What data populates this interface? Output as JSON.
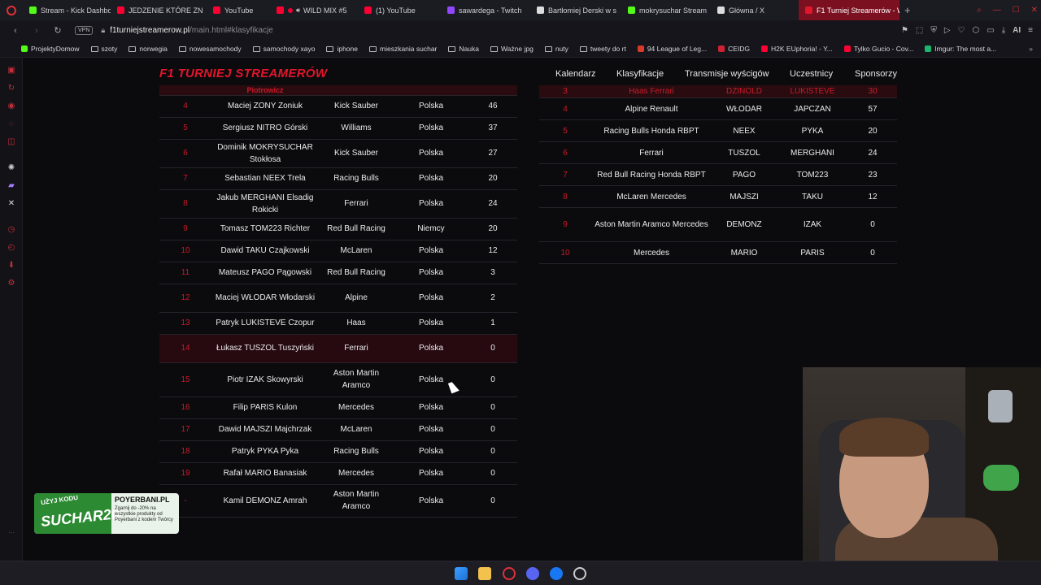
{
  "browser": {
    "tabs": [
      {
        "label": "Stream - Kick Dashbo",
        "color": "#53fc18",
        "active": false
      },
      {
        "label": "JEDZENIE KTÓRE ZN",
        "color": "#ff0033",
        "active": false
      },
      {
        "label": "YouTube",
        "color": "#ff0033",
        "active": false
      },
      {
        "label": "WILD MIX #5",
        "color": "#ff0033",
        "active": false
      },
      {
        "label": "(1) YouTube",
        "color": "#ff0033",
        "active": false
      },
      {
        "label": "sawardega - Twitch",
        "color": "#9146ff",
        "active": false
      },
      {
        "label": "Bartłomiej Derski w s",
        "color": "#dddddd",
        "active": false
      },
      {
        "label": "mokrysuchar Stream",
        "color": "#53fc18",
        "active": false
      },
      {
        "label": "Główna / X",
        "color": "#dddddd",
        "active": false
      },
      {
        "label": "F1 Turniej Streamerów - W",
        "color": "#e0162b",
        "active": true
      }
    ],
    "new_tab": "+",
    "url_host": "f1turniejstreamerow.pl",
    "url_path": "/main.html#klasyfikacje",
    "vpn_label": "VPN",
    "ai_label": "AI",
    "bookmarks": [
      {
        "label": "ProjektyDomow",
        "kind": "dot",
        "color": "#53fc18"
      },
      {
        "label": "szoty",
        "kind": "folder"
      },
      {
        "label": "norwegia",
        "kind": "folder"
      },
      {
        "label": "nowesamochody",
        "kind": "folder"
      },
      {
        "label": "samochody xayo",
        "kind": "folder"
      },
      {
        "label": "iphone",
        "kind": "folder"
      },
      {
        "label": "mieszkania suchar",
        "kind": "folder"
      },
      {
        "label": "Nauka",
        "kind": "folder"
      },
      {
        "label": "Ważne jpg",
        "kind": "folder"
      },
      {
        "label": "nuty",
        "kind": "folder"
      },
      {
        "label": "tweety do rt",
        "kind": "folder"
      },
      {
        "label": "94 League of Leg...",
        "kind": "dot",
        "color": "#d83a2a"
      },
      {
        "label": "CEIDG",
        "kind": "dot",
        "color": "#cc2233"
      },
      {
        "label": "H2K EUphoria! - Y...",
        "kind": "dot",
        "color": "#ff0033"
      },
      {
        "label": "Tylko Gucio - Cov...",
        "kind": "dot",
        "color": "#ff0033"
      },
      {
        "label": "Imgur: The most a...",
        "kind": "dot",
        "color": "#1bb76e"
      }
    ]
  },
  "site": {
    "logo": "F1 TURNIEJ STREAMERÓW",
    "nav": [
      "Kalendarz",
      "Klasyfikacje",
      "Transmisje wyścigów",
      "Uczestnicy",
      "Sponsorzy"
    ],
    "accent": "#e0162b"
  },
  "drivers_table": {
    "partial_top_label": "Piotrowicz",
    "rows": [
      {
        "pos": "4",
        "name": "Maciej ZONY Zoniuk",
        "team": "Kick Sauber",
        "country": "Polska",
        "points": "46"
      },
      {
        "pos": "5",
        "name": "Sergiusz NITRO Górski",
        "team": "Williams",
        "country": "Polska",
        "points": "37"
      },
      {
        "pos": "6",
        "name": "Dominik MOKRYSUCHAR Stokłosa",
        "team": "Kick Sauber",
        "country": "Polska",
        "points": "27"
      },
      {
        "pos": "7",
        "name": "Sebastian NEEX Trela",
        "team": "Racing Bulls",
        "country": "Polska",
        "points": "20"
      },
      {
        "pos": "8",
        "name": "Jakub MERGHANI Elsadig Rokicki",
        "team": "Ferrari",
        "country": "Polska",
        "points": "24"
      },
      {
        "pos": "9",
        "name": "Tomasz TOM223 Richter",
        "team": "Red Bull Racing",
        "country": "Niemcy",
        "points": "20"
      },
      {
        "pos": "10",
        "name": "Dawid TAKU Czajkowski",
        "team": "McLaren",
        "country": "Polska",
        "points": "12"
      },
      {
        "pos": "11",
        "name": "Mateusz PAGO Pągowski",
        "team": "Red Bull Racing",
        "country": "Polska",
        "points": "3"
      },
      {
        "pos": "12",
        "name": "Maciej WŁODAR Włodarski",
        "team": "Alpine",
        "country": "Polska",
        "points": "2"
      },
      {
        "pos": "13",
        "name": "Patryk LUKISTEVE Czopur",
        "team": "Haas",
        "country": "Polska",
        "points": "1"
      },
      {
        "pos": "14",
        "name": "Łukasz TUSZOL Tuszyński",
        "team": "Ferrari",
        "country": "Polska",
        "points": "0"
      },
      {
        "pos": "15",
        "name": "Piotr IZAK Skowyrski",
        "team": "Aston Martin Aramco",
        "country": "Polska",
        "points": "0"
      },
      {
        "pos": "16",
        "name": "Filip PARIS Kulon",
        "team": "Mercedes",
        "country": "Polska",
        "points": "0"
      },
      {
        "pos": "17",
        "name": "Dawid MAJSZI Majchrzak",
        "team": "McLaren",
        "country": "Polska",
        "points": "0"
      },
      {
        "pos": "18",
        "name": "Patryk PYKA Pyka",
        "team": "Racing Bulls",
        "country": "Polska",
        "points": "0"
      },
      {
        "pos": "19",
        "name": "Rafał MARIO Banasiak",
        "team": "Mercedes",
        "country": "Polska",
        "points": "0"
      },
      {
        "pos": "-",
        "name": "Kamil DEMONZ Amrah",
        "team": "Aston Martin Aramco",
        "country": "Polska",
        "points": "0"
      }
    ]
  },
  "teams_table": {
    "partial_top": {
      "pos": "3",
      "team": "Haas Ferrari",
      "d1": "DZINOLD",
      "d2": "LUKISTEVE",
      "points": "30"
    },
    "rows": [
      {
        "pos": "4",
        "team": "Alpine Renault",
        "d1": "WŁODAR",
        "d2": "JAPCZAN",
        "points": "57"
      },
      {
        "pos": "5",
        "team": "Racing Bulls Honda RBPT",
        "d1": "NEEX",
        "d2": "PYKA",
        "points": "20"
      },
      {
        "pos": "6",
        "team": "Ferrari",
        "d1": "TUSZOL",
        "d2": "MERGHANI",
        "points": "24"
      },
      {
        "pos": "7",
        "team": "Red Bull Racing Honda RBPT",
        "d1": "PAGO",
        "d2": "TOM223",
        "points": "23"
      },
      {
        "pos": "8",
        "team": "McLaren Mercedes",
        "d1": "MAJSZI",
        "d2": "TAKU",
        "points": "12"
      },
      {
        "pos": "9",
        "team": "Aston Martin Aramco Mercedes",
        "d1": "DEMONZ",
        "d2": "IZAK",
        "points": "0"
      },
      {
        "pos": "10",
        "team": "Mercedes",
        "d1": "MARIO",
        "d2": "PARIS",
        "points": "0"
      }
    ]
  },
  "promo": {
    "code_prefix": "UŻYJ KODU",
    "code": "SUCHAR20",
    "brand": "POYERBANI.PL",
    "text": "Zgarnij do -20% na wszystkie produkty od Poyerbani z kodem Twórcy"
  }
}
